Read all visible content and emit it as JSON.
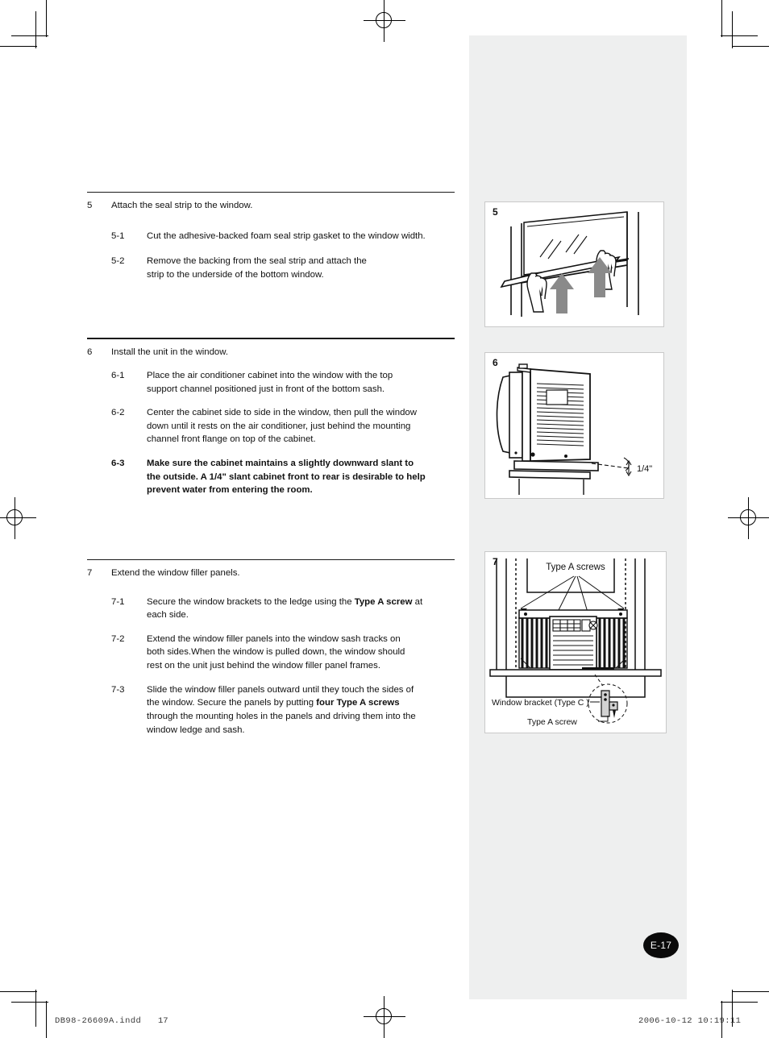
{
  "page": {
    "badge": "E-17",
    "background_color": "#ffffff",
    "panel_color": "#eeefef"
  },
  "steps": [
    {
      "number": "5",
      "title": "Attach the seal strip to the window.",
      "substeps": [
        {
          "number": "5-1",
          "text": "Cut the adhesive-backed foam seal strip gasket to the window width.",
          "bold": false
        },
        {
          "number": "5-2",
          "text": "Remove the backing from the seal strip and attach the strip to the underside of the bottom window.",
          "bold": false
        }
      ]
    },
    {
      "number": "6",
      "title": "Install the unit in the window.",
      "substeps": [
        {
          "number": "6-1",
          "text": "Place the air conditioner cabinet into the window with the top support channel positioned just in front of the bottom sash.",
          "bold": false
        },
        {
          "number": "6-2",
          "text": "Center the cabinet side to side in the window, then pull the window down until it rests on the air conditioner, just behind the mounting channel front flange on top of the cabinet.",
          "bold": false
        },
        {
          "number": "6-3",
          "text": "Make sure the cabinet maintains a slightly downward slant to the outside. A 1/4\" slant cabinet front to rear is desirable to help prevent water from entering the room.",
          "bold": true
        }
      ]
    },
    {
      "number": "7",
      "title": "Extend the window filler panels.",
      "substeps": [
        {
          "number": "7-1",
          "html": "Secure the window brackets to the ledge using the <b>Type A screw</b> at each side.",
          "bold": false
        },
        {
          "number": "7-2",
          "html": "Extend the window filler panels into the window sash tracks on both sides.When the window is pulled down, the window should rest on the unit just behind the window filler panel frames.",
          "bold": false
        },
        {
          "number": "7-3",
          "html": "Slide the window filler panels outward until they touch the sides of the window. Secure the panels by putting <b>four Type A screws</b> through the mounting holes in the panels and driving them into the window ledge and sash.",
          "bold": false
        }
      ]
    }
  ],
  "figures": [
    {
      "number": "5",
      "caption_labels": []
    },
    {
      "number": "6",
      "caption_labels": [
        "1/4\""
      ]
    },
    {
      "number": "7",
      "caption_labels": [
        "Type  A  screws",
        "Window bracket (Type  C )",
        "Type  A  screw"
      ]
    }
  ],
  "figure6": {
    "slant_label": "1/4\""
  },
  "figure7": {
    "top_label": "Type  A  screws",
    "bracket_label": "Window bracket (Type  C )",
    "screw_label": "Type  A  screw"
  },
  "footer": {
    "file": "DB98-26609A.indd",
    "page": "17",
    "timestamp": "2006-10-12   10:19:11"
  }
}
